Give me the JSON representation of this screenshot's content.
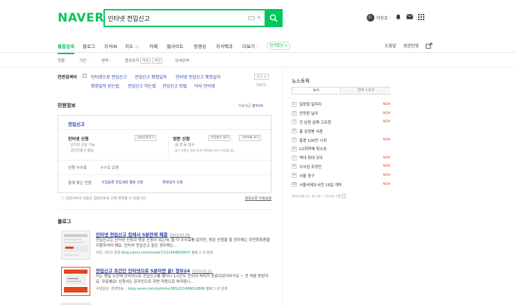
{
  "logo": "NAVER",
  "search": {
    "query": "인터넷 전입신고"
  },
  "header": {
    "user_name": "이승호 ·"
  },
  "tabs": [
    {
      "label": "통합검색"
    },
    {
      "label": "블로그"
    },
    {
      "label": "지식iN"
    },
    {
      "label": "지도"
    },
    {
      "label": "카페"
    },
    {
      "label": "웹사이트"
    },
    {
      "label": "동영상"
    },
    {
      "label": "지식백과"
    },
    {
      "label": "더보기 ·"
    }
  ],
  "tab_option": "검색옵션 ∧",
  "tab_right": {
    "help": "도움말",
    "settings": "원본반영"
  },
  "filters": {
    "sort": "정렬 ·",
    "period": "기간 ·",
    "area": "영역 ·",
    "option_prefix": "옵션유지",
    "option_on": "꺼짐",
    "option_off": "켜짐",
    "detail": "상세검색 ·"
  },
  "related": {
    "title": "연관검색어",
    "help": "?",
    "items": [
      "인터넷으로 전입신고",
      "전입신고 확정일자",
      "인터넷 전입신고 확정일자",
      "확정일자 받는법",
      "전입신고 하는법",
      "전입신고 방법",
      "이사 인터넷"
    ],
    "close": "신고 ×",
    "more": "더보기 ·"
  },
  "civil": {
    "section_title": "민원정보",
    "provider_prefix": "자료제공",
    "provider": "정부24",
    "card_title": "전입신고",
    "left": {
      "title": "인터넷 신청",
      "button": "민원신청하기",
      "notes": [
        "· 인터넷 신청 가능",
        "· 공인인증서 필요"
      ]
    },
    "right": {
      "title": "방문 신청",
      "button1": "주민센터 찾기",
      "button2": "구비서류 보기",
      "notes": [
        "· 읍,면,동 접수",
        "· 접수 인원은 현장 자격 기준에서 처리 가능합니다."
      ]
    },
    "fee_label": "신청 수수료",
    "fee_value": "수수료 없음",
    "assoc_label": "함께 찾는 민원",
    "assoc_links": [
      "수입등록 전입세대 열람 신청",
      "확정일자 신청"
    ],
    "notice": "ⓘ 민원사무의 내용은 업데이트로 인해 변경될 수 있습니다.",
    "notice_link": "정보오류 수정요청"
  },
  "blog": {
    "section_title": "블로그",
    "items": [
      {
        "title": "인터넷 전입신고 집에서 5분만에 해결",
        "date": "2019.03.09.",
        "desc": "전입신고는 인터넷 신청과 방문 신청이 있는데, 둘 다 수수료를 없지만, 방문 신청을 할 경우에는 주민등록증을 지참하셔야 해요. 인터넷 전입신고 같은 경우에는...",
        "source": "사진 그리고 감성",
        "url": "blog.naver.com/lovesk7/221494009547",
        "more": "블로그 내 검색"
      },
      {
        "title": "전입신고 초간단 인터넷으로 5분이면 끝! 정부24",
        "date": "2019.03.21.",
        "desc": "저는 평일 오전에 인터넷으로 전입신고를 했더니 1시간도 안되서 처리가 완료되었더라구요 ~ 전 처음 받았어요. 무료예요! 신청서는 온라인으로 하면 자동으로 처리된니...",
        "source": "수원일상, 생생방송...",
        "url": "blog.naver.com/optimiss365/221499618886",
        "more": "블로그 내 검색"
      }
    ]
  },
  "news_topic": {
    "title": "뉴스토픽",
    "tabs": [
      "뉴스",
      "연예 스포츠"
    ],
    "items": [
      {
        "rank": "1",
        "text": "밀양형 일자리",
        "badge": "NEW"
      },
      {
        "rank": "2",
        "text": "안양판 날아",
        "badge": "NEW"
      },
      {
        "rank": "3",
        "text": "전 남편 살해 고유정",
        "badge": "NEW"
      },
      {
        "rank": "4",
        "text": "흉 김원봉 서훈",
        "badge": ""
      },
      {
        "rank": "5",
        "text": "홍콩 100만 시위",
        "badge": "NEW"
      },
      {
        "rank": "6",
        "text": "LG화학에 맞소송",
        "badge": ""
      },
      {
        "rank": "7",
        "text": "역대 최대 규모",
        "badge": "NEW"
      },
      {
        "rank": "8",
        "text": "수사권 조정안",
        "badge": "NEW"
      },
      {
        "rank": "9",
        "text": "서울 중구",
        "badge": "NEW"
      },
      {
        "rank": "10",
        "text": "서울국제도서전 19일 개막",
        "badge": "NEW"
      }
    ],
    "timestamp": "2019.06.11. 02:38 ~ 05:00 기준",
    "timestamp_icon": "?"
  },
  "colors": {
    "brand": "#03c75a",
    "link": "#2a3fa8",
    "badge": "#e3451e"
  }
}
